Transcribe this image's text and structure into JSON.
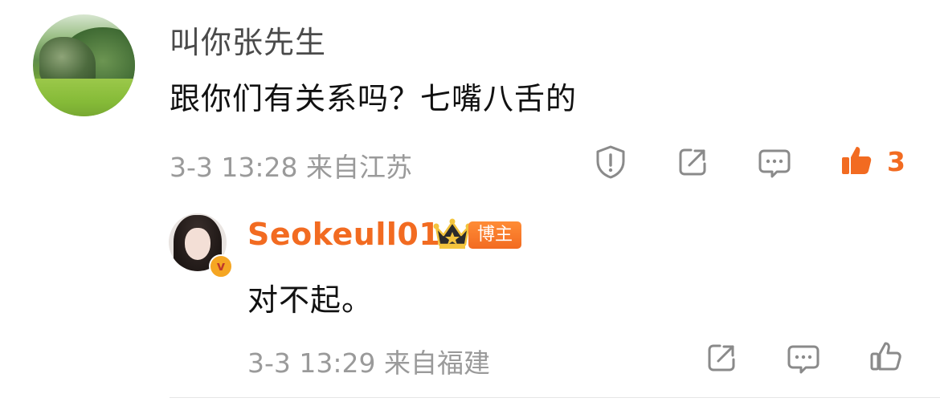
{
  "comment": {
    "username": "叫你张先生",
    "text": "跟你们有关系吗？七嘴八舌的",
    "date": "3-3 13:28",
    "location": "来自江苏",
    "like_count": "3",
    "accent_color": "#f26b21",
    "actions": [
      "report-icon",
      "share-icon",
      "comment-icon",
      "like-icon"
    ]
  },
  "reply": {
    "username": "Seokeull01",
    "verified_badge": "v",
    "author_tag": "博主",
    "text": "对不起。",
    "date": "3-3 13:29",
    "location": "来自福建",
    "actions": [
      "share-icon",
      "comment-icon",
      "like-icon"
    ]
  }
}
